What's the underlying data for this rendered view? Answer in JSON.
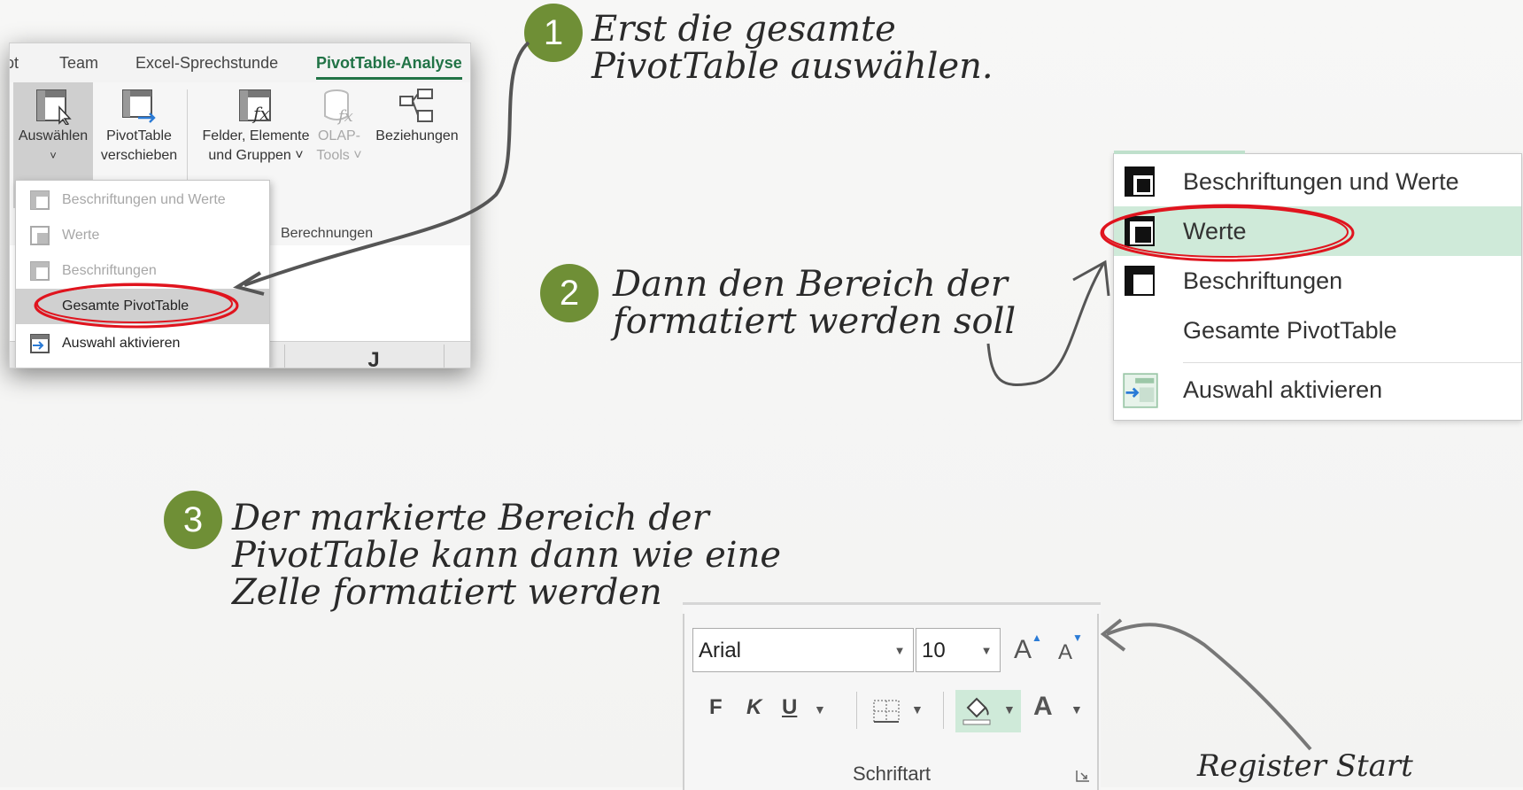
{
  "step1": {
    "badge": "1",
    "note_line1": "Erst die gesamte",
    "note_line2": "PivotTable auswählen."
  },
  "step2": {
    "badge": "2",
    "note_line1": "Dann den Bereich der",
    "note_line2": "formatiert werden soll"
  },
  "step3": {
    "badge": "3",
    "note_line1": "Der markierte Bereich der",
    "note_line2": "PivotTable kann dann wie eine",
    "note_line3": "Zelle formatiert werden"
  },
  "register_note": "Register Start",
  "excel_ribbon": {
    "tabs": [
      "ɔt",
      "Team",
      "Excel-Sprechstunde",
      "PivotTable-Analyse"
    ],
    "active_tab": "PivotTable-Analyse",
    "buttons": {
      "auswaehlen": "Auswählen",
      "auswaehlen_arrow": "˅",
      "pivottable_line1": "PivotTable",
      "pivottable_line2": "verschieben",
      "felder_line1": "Felder, Elemente",
      "felder_line2": "und Gruppen ˅",
      "olap_line1": "OLAP-",
      "olap_line2": "Tools ˅",
      "beziehungen": "Beziehungen"
    },
    "group_label": "Berechnungen",
    "column_header": "J",
    "menu": [
      {
        "label": "Beschriftungen und Werte",
        "state": "disabled"
      },
      {
        "label": "Werte",
        "state": "disabled"
      },
      {
        "label": "Beschriftungen",
        "state": "disabled"
      },
      {
        "label": "Gesamte PivotTable",
        "state": "selected"
      },
      {
        "label": "Auswahl aktivieren",
        "state": "enabled"
      }
    ]
  },
  "context_menu": [
    {
      "label": "Beschriftungen und Werte",
      "icon": "pivot-labels-values-icon"
    },
    {
      "label": "Werte",
      "icon": "pivot-values-icon",
      "state": "selected"
    },
    {
      "label": "Beschriftungen",
      "icon": "pivot-labels-icon"
    },
    {
      "label": "Gesamte PivotTable",
      "icon": ""
    },
    {
      "label": "Auswahl aktivieren",
      "icon": "enable-selection-icon"
    }
  ],
  "font_group": {
    "font_name": "Arial",
    "font_size": "10",
    "bold": "F",
    "italic": "K",
    "underline": "U",
    "grow_font": "A",
    "shrink_font": "A",
    "font_color": "A",
    "group_name": "Schriftart"
  },
  "colors": {
    "badge": "#6f8f36",
    "excel_green": "#217346",
    "highlight_ring": "#e0141e",
    "selected_row": "#cfead9",
    "arrow": "#555555"
  }
}
